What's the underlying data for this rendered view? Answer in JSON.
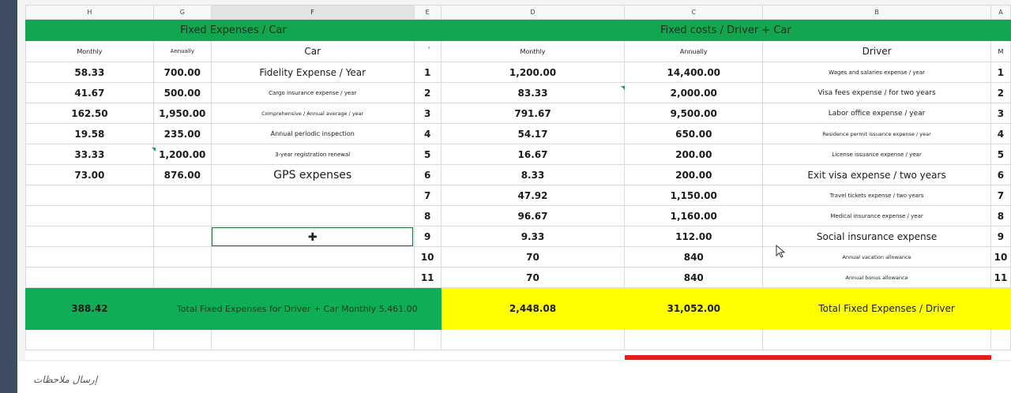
{
  "columns": [
    "H",
    "G",
    "F",
    "E",
    "D",
    "C",
    "B",
    "A"
  ],
  "titles": {
    "car": "Fixed Expenses / Car",
    "driver_car": "Fixed costs / Driver + Car"
  },
  "subheaders": {
    "h": "Monthly",
    "g": "Annually",
    "f": "Car",
    "e": "ٔ",
    "d": "Monthly",
    "c": "Annually",
    "b": "Driver",
    "a": "M"
  },
  "rows": [
    {
      "h": "58.33",
      "g": "700.00",
      "f": "Fidelity Expense / Year",
      "e": "1",
      "d": "1,200.00",
      "c": "14,400.00",
      "b": "Wages and salaries expense / year",
      "a": "1"
    },
    {
      "h": "41.67",
      "g": "500.00",
      "f": "Cargo insurance expense / year",
      "e": "2",
      "d": "83.33",
      "c": "2,000.00",
      "b": "Visa fees expense / for two years",
      "a": "2"
    },
    {
      "h": "162.50",
      "g": "1,950.00",
      "f": "Comprehensive / Annual average / year",
      "e": "3",
      "d": "791.67",
      "c": "9,500.00",
      "b": "Labor office expense / year",
      "a": "3"
    },
    {
      "h": "19.58",
      "g": "235.00",
      "f": "Annual periodic inspection",
      "e": "4",
      "d": "54.17",
      "c": "650.00",
      "b": "Residence permit issuance expense / year",
      "a": "4"
    },
    {
      "h": "33.33",
      "g": "1,200.00",
      "f": "3-year registration renewal",
      "e": "5",
      "d": "16.67",
      "c": "200.00",
      "b": "License issuance expense / year",
      "a": "5"
    },
    {
      "h": "73.00",
      "g": "876.00",
      "f": "GPS expenses",
      "e": "6",
      "d": "8.33",
      "c": "200.00",
      "b": "Exit visa expense / two years",
      "a": "6"
    },
    {
      "h": "",
      "g": "",
      "f": "",
      "e": "7",
      "d": "47.92",
      "c": "1,150.00",
      "b": "Travel tickets expense / two years",
      "a": "7"
    },
    {
      "h": "",
      "g": "",
      "f": "",
      "e": "8",
      "d": "96.67",
      "c": "1,160.00",
      "b": "Medical insurance expense / year",
      "a": "8"
    },
    {
      "h": "",
      "g": "",
      "f": "",
      "e": "9",
      "d": "9.33",
      "c": "112.00",
      "b": "Social insurance expense",
      "a": "9"
    },
    {
      "h": "",
      "g": "",
      "f": "",
      "e": "10",
      "d": "70",
      "c": "840",
      "b": "Annual vacation allowance",
      "a": "10"
    },
    {
      "h": "",
      "g": "",
      "f": "",
      "e": "11",
      "d": "70",
      "c": "840",
      "b": "Annual bonus allowance",
      "a": "11"
    }
  ],
  "totals": {
    "h": "388.42",
    "combined_label": "Total Fixed Expenses for Driver + Car Monthly 5,461.00",
    "d": "2,448.08",
    "c": "31,052.00",
    "driver_label": "Total Fixed Expenses / Driver"
  },
  "status_text": "إرسال ملاحظات",
  "colors": {
    "green": "#13a651",
    "yellow": "#ffff00",
    "red": "#e51c17"
  }
}
